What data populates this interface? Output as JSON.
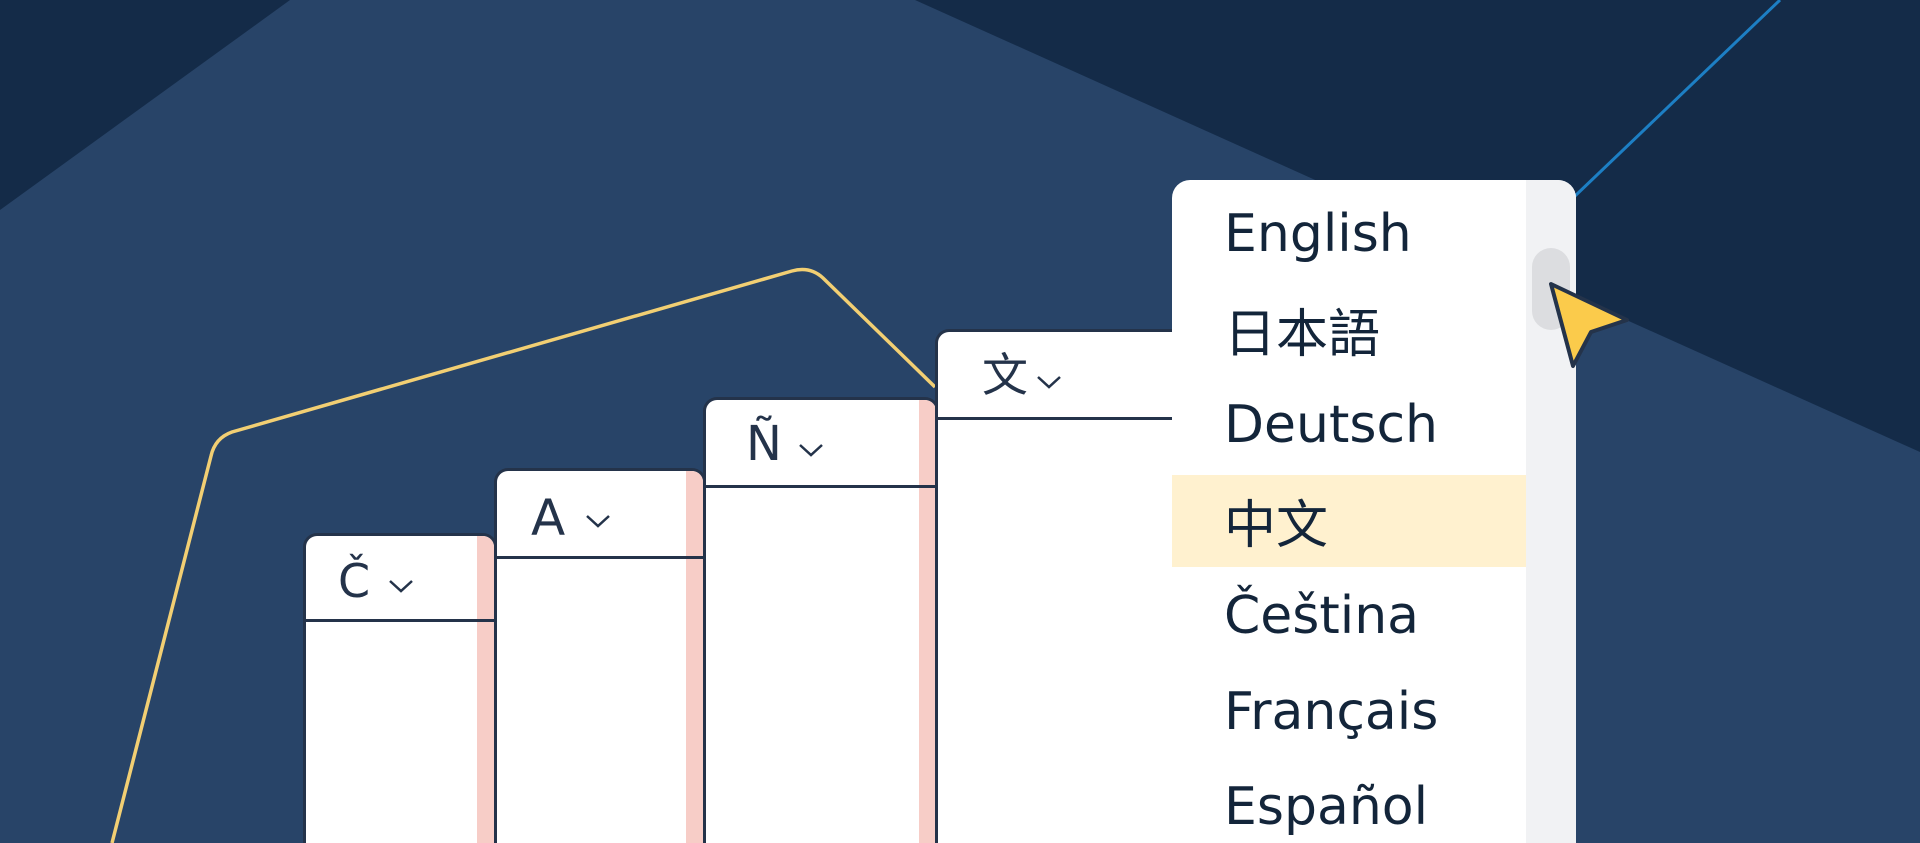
{
  "cards": [
    {
      "id": "czech",
      "glyph": "Č"
    },
    {
      "id": "latin",
      "glyph": "A"
    },
    {
      "id": "spanish",
      "glyph": "Ñ"
    },
    {
      "id": "chinese",
      "glyph": "文"
    }
  ],
  "dropdown": {
    "items": [
      {
        "label": "English"
      },
      {
        "label": "日本語"
      },
      {
        "label": "Deutsch"
      },
      {
        "label": "中文",
        "selected": true
      },
      {
        "label": "Čeština"
      },
      {
        "label": "Français"
      },
      {
        "label": "Español"
      }
    ]
  },
  "icons": {
    "chevron": "chevron-down-icon",
    "cursor": "pointer-cursor-icon"
  },
  "colors": {
    "background": "#284468",
    "dark_shape": "#142b48",
    "gold_line": "#f2cf73",
    "blue_line": "#1d7fc4",
    "accent_stripe": "#f7cdc7",
    "selected_row": "#fff1cf",
    "cursor": "#fbcb4b"
  }
}
